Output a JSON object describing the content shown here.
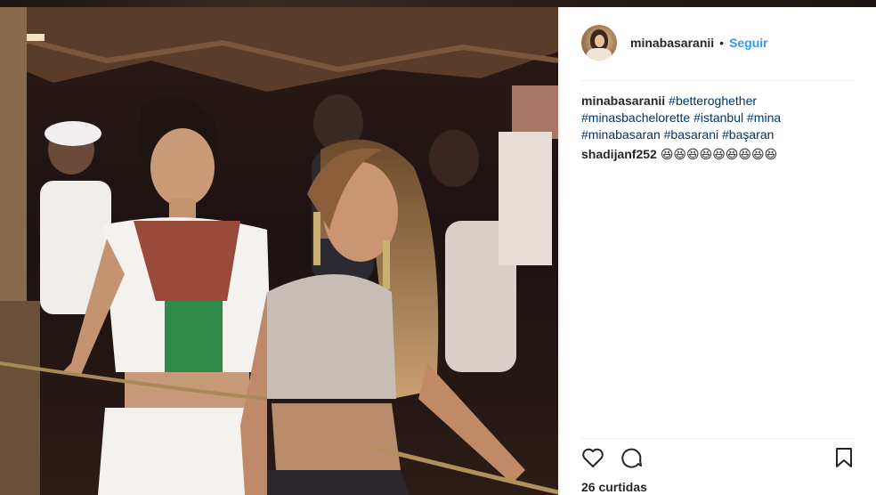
{
  "post": {
    "username": "minabasaranii",
    "separator": "•",
    "follow_label": "Seguir",
    "caption": {
      "user": "minabasaranii",
      "hashtags": [
        "#betteroghether",
        "#minasbachelorette",
        "#istanbul",
        "#mina",
        "#minabasaran",
        "#basarani",
        "#başaran"
      ]
    },
    "comments": [
      {
        "user": "shadijanf252",
        "text": "😆😆😆😆😆😆😆😆😆"
      }
    ],
    "likes_text": "26 curtidas"
  },
  "icons": {
    "like": "heart-icon",
    "comment": "comment-icon",
    "save": "bookmark-icon"
  },
  "colors": {
    "link": "#3897f0",
    "hashtag": "#003569",
    "text": "#262626"
  }
}
